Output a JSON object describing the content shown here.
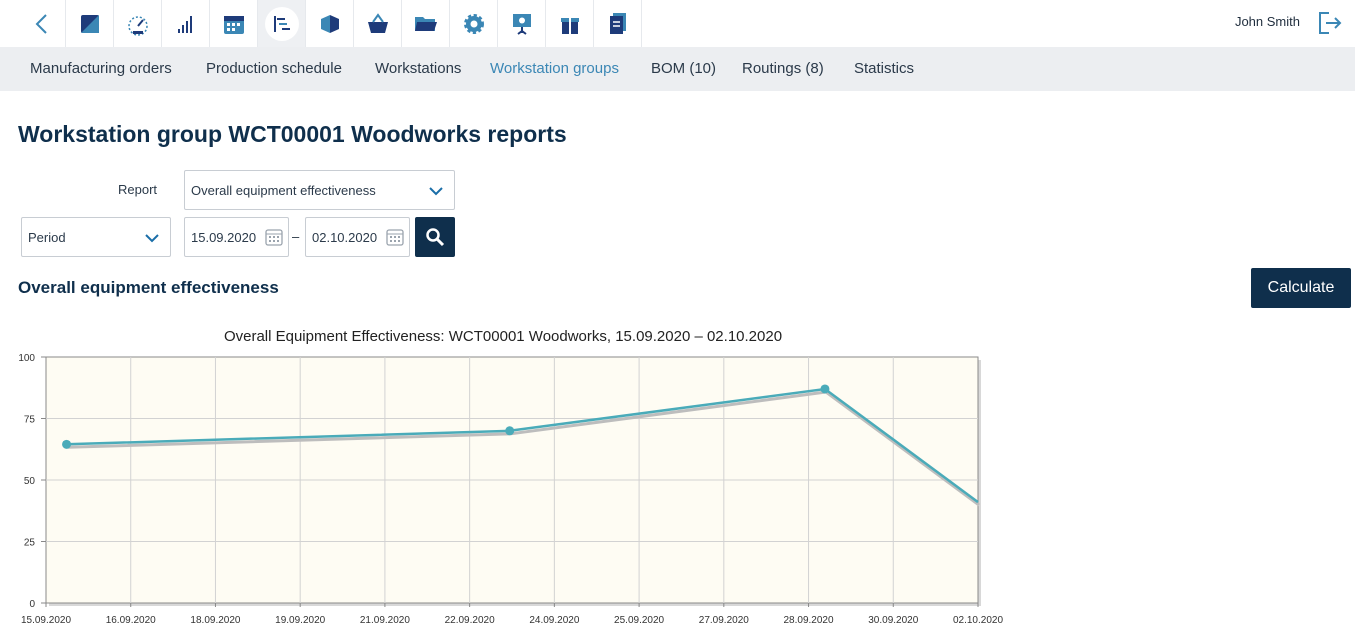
{
  "topbar": {
    "icons": [
      "back-chevron-icon",
      "dashboard-icon",
      "gauge-icon",
      "signal-bars-icon",
      "calendar-icon",
      "gantt-icon",
      "cube-icon",
      "basket-icon",
      "folder-icon",
      "gear-icon",
      "presentation-icon",
      "gift-icon",
      "document-icon"
    ],
    "active_index": 5,
    "user_name": "John Smith",
    "accent": "#3b87b5",
    "dark": "#0f2f4c"
  },
  "subnav": {
    "items": [
      "Manufacturing orders",
      "Production schedule",
      "Workstations",
      "Workstation groups",
      "BOM (10)",
      "Routings (8)",
      "Statistics"
    ],
    "active": "Workstation groups"
  },
  "page": {
    "title": "Workstation group WCT00001 Woodworks reports",
    "report_label": "Report",
    "report_value": "Overall equipment effectiveness",
    "period_value": "Period",
    "date_from": "15.09.2020",
    "date_separator": "–",
    "date_to": "02.10.2020",
    "section_title": "Overall equipment effectiveness",
    "calculate_label": "Calculate"
  },
  "chart_data": {
    "type": "line",
    "title": "Overall Equipment Effectiveness: WCT00001 Woodworks, 15.09.2020 – 02.10.2020",
    "x_ticks": [
      "15.09.2020",
      "16.09.2020",
      "18.09.2020",
      "19.09.2020",
      "21.09.2020",
      "22.09.2020",
      "24.09.2020",
      "25.09.2020",
      "27.09.2020",
      "28.09.2020",
      "30.09.2020",
      "02.10.2020"
    ],
    "y_ticks": [
      0,
      25,
      50,
      75,
      100
    ],
    "ylim": [
      0,
      100
    ],
    "series": [
      {
        "color": "#4aabb9",
        "points": [
          {
            "x": "2020-09-15T09:00",
            "y": 64.5
          },
          {
            "x": "2020-09-23T11:00",
            "y": 70
          },
          {
            "x": "2020-09-29T05:00",
            "y": 87
          },
          {
            "x": "2020-10-02T00:00",
            "y": 41
          }
        ],
        "markers": [
          true,
          true,
          true,
          false
        ]
      }
    ],
    "grid": true,
    "background": "#fefcf3"
  }
}
